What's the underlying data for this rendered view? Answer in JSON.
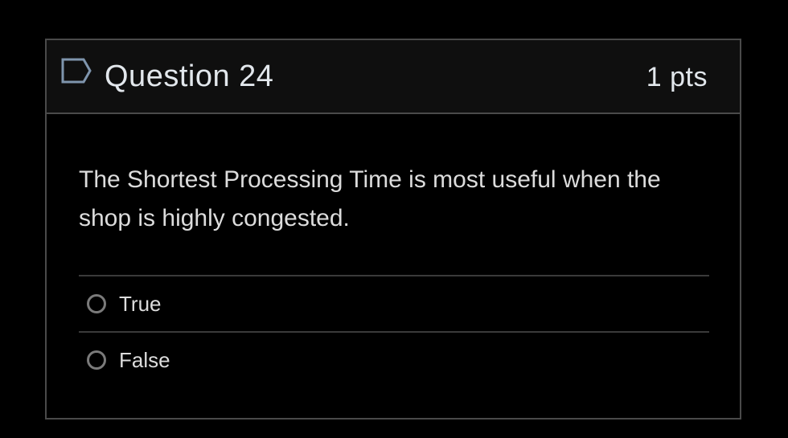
{
  "question": {
    "title": "Question 24",
    "points": "1 pts",
    "text": "The Shortest Processing Time is most useful when the shop is highly congested.",
    "flag_icon": "flag-icon",
    "answers": [
      {
        "label": "True",
        "selected": false
      },
      {
        "label": "False",
        "selected": false
      }
    ]
  },
  "colors": {
    "background": "#000000",
    "header_background": "#0f0f0f",
    "border": "#4a4a4a",
    "text": "#dcdcdc",
    "title_text": "#e2e7ec",
    "flag_stroke": "#7f95ad"
  }
}
